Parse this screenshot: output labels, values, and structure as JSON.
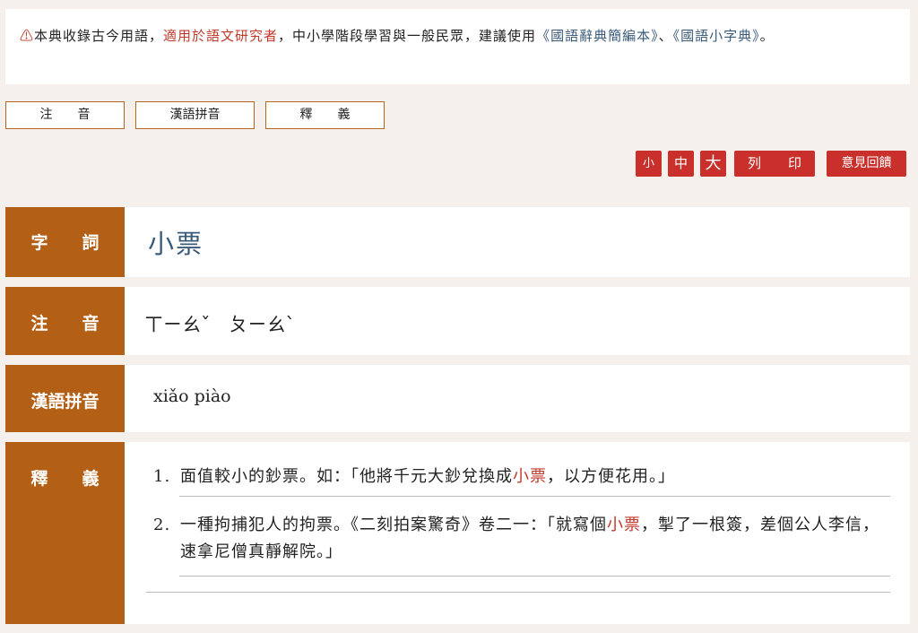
{
  "notice": {
    "warning_glyph": "⚠",
    "text_1": "本典收錄古今用語，",
    "highlight": "適用於語文研究者",
    "text_2": "，中小學階段學習與一般民眾，建議使用",
    "link_1": "《國語辭典簡編本》",
    "sep": "、",
    "link_2": "《國語小字典》",
    "end": "。"
  },
  "tabs": [
    "注　　音",
    "漢語拼音",
    "釋　　義"
  ],
  "toolbar": {
    "font_small": "小",
    "font_medium": "中",
    "font_large": "大",
    "print": "列　　印",
    "feedback": "意見回饋"
  },
  "entry": {
    "word_label": "字　　詞",
    "word": "小票",
    "zhuyin_label": "注　　音",
    "zhuyin": "ㄒㄧㄠˇ　ㄆㄧㄠˋ",
    "pinyin_label": "漢語拼音",
    "pinyin": "xiǎo  piào",
    "definition_label": "釋　　義",
    "definitions": [
      {
        "num": "1.",
        "pre": "面值較小的鈔票。如：「他將千元大鈔兌換成",
        "hl": "小票",
        "post": "，以方便花用。」"
      },
      {
        "num": "2.",
        "pre": "一種拘捕犯人的拘票。《二刻拍案驚奇》卷二一：「就寫個",
        "hl": "小票",
        "post": "，掣了一根簽，差個公人李信，速拿尼僧真靜解院。」"
      }
    ]
  },
  "colors": {
    "accent_brown": "#b35f15",
    "button_red": "#c9302c",
    "highlight_red": "#c0392b",
    "link_blue": "#3a5a7a"
  }
}
